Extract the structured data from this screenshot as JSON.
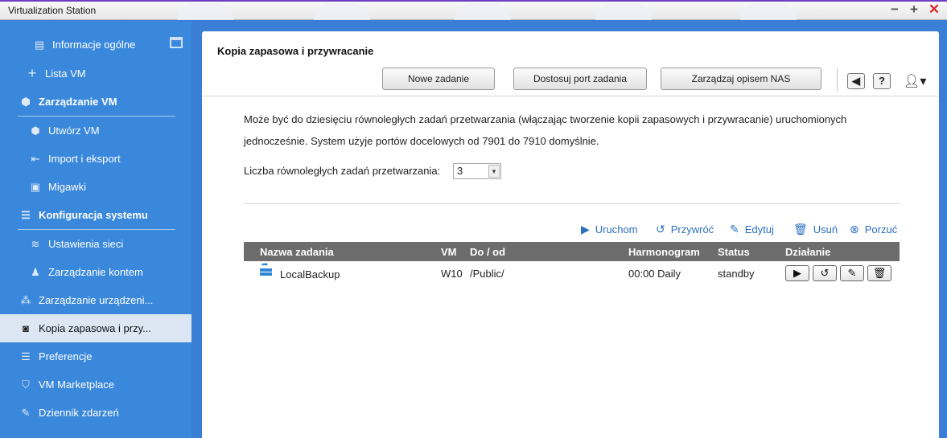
{
  "window": {
    "title": "Virtualization Station"
  },
  "sidebar": {
    "items": [
      {
        "label": "Informacje ogólne"
      },
      {
        "label": "Lista VM"
      },
      {
        "label": "Zarządzanie VM"
      },
      {
        "label": "Utwórz VM"
      },
      {
        "label": "Import i eksport"
      },
      {
        "label": "Migawki"
      },
      {
        "label": "Konfiguracja systemu"
      },
      {
        "label": "Ustawienia sieci"
      },
      {
        "label": "Zarządzanie kontem"
      },
      {
        "label": "Zarządzanie urządzeni..."
      },
      {
        "label": "Kopia zapasowa i przy..."
      },
      {
        "label": "Preferencje"
      },
      {
        "label": "VM Marketplace"
      },
      {
        "label": "Dziennik zdarzeń"
      }
    ]
  },
  "main": {
    "title": "Kopia zapasowa i przywracanie",
    "toolbar": {
      "new_task": "Nowe zadanie",
      "adjust_port": "Dostosuj port zadania",
      "manage_nas": "Zarządzaj opisem NAS",
      "help": "?"
    },
    "description": "Może być do dziesięciu równoległych zadań przetwarzania (włączając tworzenie kopii zapasowych i przywracanie) uruchomionych jednocześnie. System użyje portów docelowych od 7901 do 7910 domyślnie.",
    "parallel_label": "Liczba równoległych zadań przetwarzania:",
    "parallel_value": "3",
    "actions": {
      "run": "Uruchom",
      "restore": "Przywróć",
      "edit": "Edytuj",
      "delete": "Usuń",
      "abort": "Porzuć"
    },
    "table": {
      "headers": {
        "name": "Nazwa zadania",
        "vm": "VM",
        "path": "Do / od",
        "schedule": "Harmonogram",
        "status": "Status",
        "action": "Działanie"
      },
      "rows": [
        {
          "name": "LocalBackup",
          "vm": "W10",
          "path": "/Public/",
          "schedule": "00:00 Daily",
          "status": "standby"
        }
      ]
    }
  },
  "colors": {
    "sidebar": "#3a88dc",
    "active": "#dde7f4",
    "link": "#2b6fc0",
    "table_header": "#6c6c6c",
    "close": "#d8262b"
  }
}
